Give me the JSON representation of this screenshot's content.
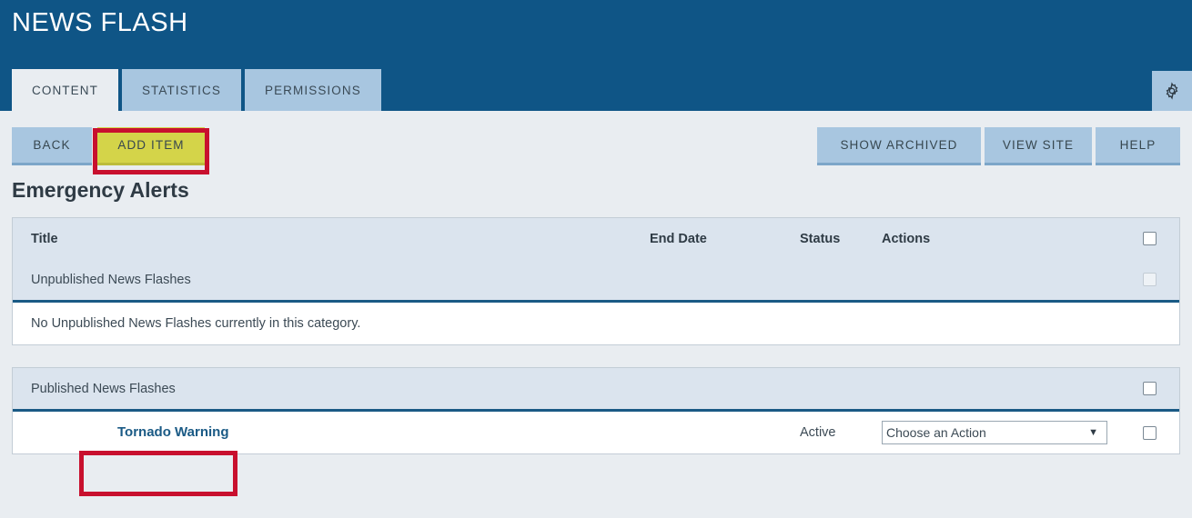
{
  "header": {
    "title": "NEWS FLASH",
    "gear_icon": "gear-icon",
    "tabs": [
      {
        "label": "CONTENT",
        "active": true
      },
      {
        "label": "STATISTICS",
        "active": false
      },
      {
        "label": "PERMISSIONS",
        "active": false
      }
    ]
  },
  "toolbar": {
    "back_label": "BACK",
    "add_item_label": "ADD ITEM",
    "show_archived_label": "SHOW ARCHIVED",
    "view_site_label": "VIEW SITE",
    "help_label": "HELP"
  },
  "page": {
    "heading": "Emergency Alerts"
  },
  "unpublished_table": {
    "columns": {
      "title": "Title",
      "end_date": "End Date",
      "status": "Status",
      "actions": "Actions"
    },
    "group_label": "Unpublished News Flashes",
    "empty_message": "No Unpublished News Flashes currently in this category."
  },
  "published_table": {
    "group_label": "Published News Flashes",
    "rows": [
      {
        "title": "Tornado Warning",
        "end_date": "",
        "status": "Active",
        "action_selected": "Choose an Action"
      }
    ]
  },
  "colors": {
    "header_blue": "#0f5586",
    "tab_inactive": "#a8c6e0",
    "page_background": "#e9edf1",
    "highlight_yellow": "#d4d449",
    "annotation_red": "#c8102e",
    "link_blue": "#1a5a85"
  }
}
